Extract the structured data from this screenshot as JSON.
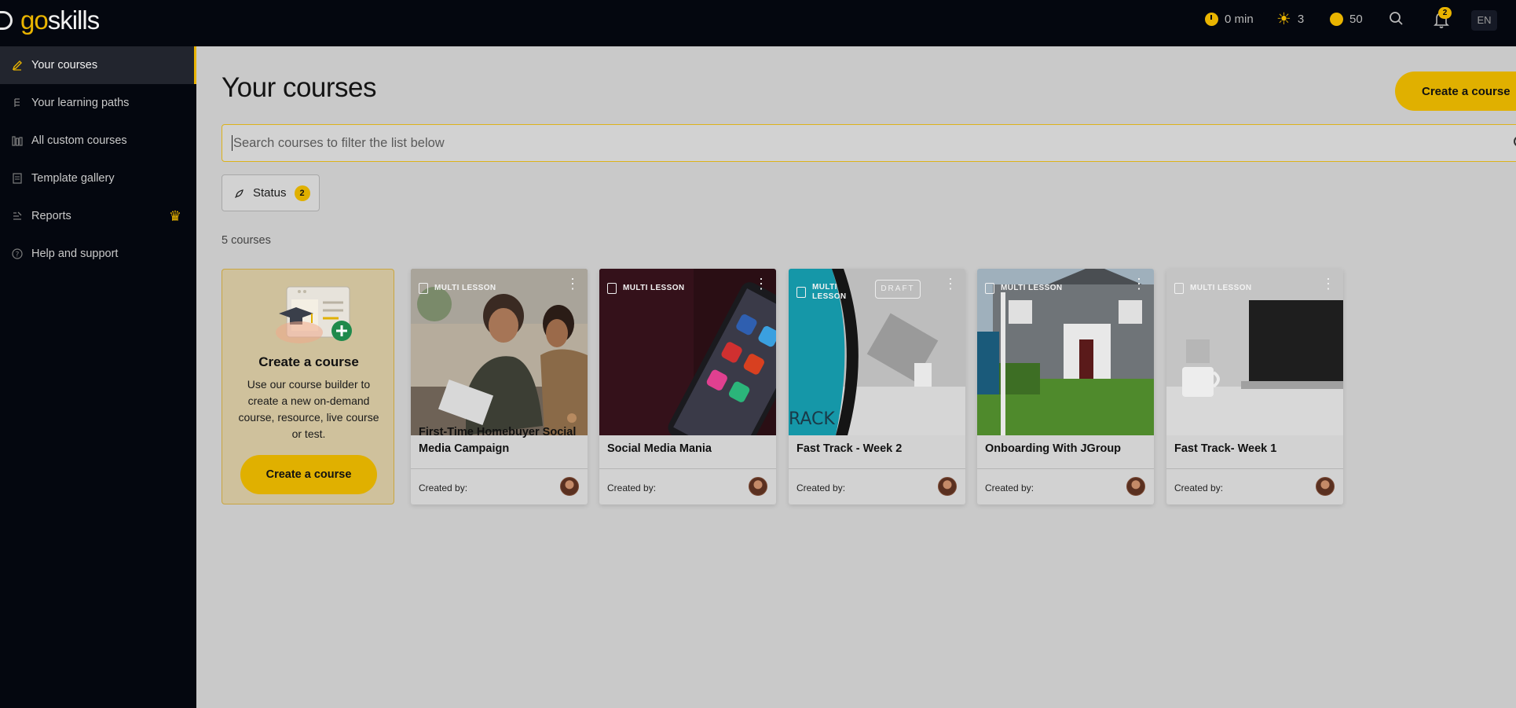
{
  "brand": {
    "go": "go",
    "skills": "skills"
  },
  "topbar": {
    "time": "0 min",
    "streak": "3",
    "coins": "50",
    "notifications_count": "2",
    "language": "EN"
  },
  "sidebar": {
    "items": [
      {
        "label": "Your courses",
        "icon": "pencil-icon",
        "active": true
      },
      {
        "label": "Your learning paths",
        "icon": "path-icon"
      },
      {
        "label": "All custom courses",
        "icon": "library-icon"
      },
      {
        "label": "Template gallery",
        "icon": "template-icon"
      },
      {
        "label": "Reports",
        "icon": "reports-icon",
        "premium": true
      },
      {
        "label": "Help and support",
        "icon": "help-icon"
      }
    ]
  },
  "main": {
    "title": "Your courses",
    "create_button": "Create a course",
    "search_placeholder": "Search courses to filter the list below",
    "status_filter": {
      "label": "Status",
      "count": "2"
    },
    "course_count": "5 courses"
  },
  "create_card": {
    "title": "Create a course",
    "description": "Use our course builder to create a new on-demand course, resource, live course or test.",
    "button": "Create a course"
  },
  "courses": [
    {
      "tag": "MULTI LESSON",
      "title": "First-Time Homebuyer Social Media Campaign",
      "created_by": "Created by:"
    },
    {
      "tag": "MULTI LESSON",
      "title": "Social Media Mania",
      "created_by": "Created by:"
    },
    {
      "tag": "MULTI LESSON",
      "title": "Fast Track - Week 2",
      "created_by": "Created by:",
      "status": "DRAFT"
    },
    {
      "tag": "MULTI LESSON",
      "title": "Onboarding With JGroup",
      "created_by": "Created by:"
    },
    {
      "tag": "MULTI LESSON",
      "title": "Fast Track- Week 1",
      "created_by": "Created by:"
    }
  ],
  "colors": {
    "accent": "#e0b000",
    "sidebar_bg": "#04070f",
    "page_bg": "#c9c9c9"
  }
}
